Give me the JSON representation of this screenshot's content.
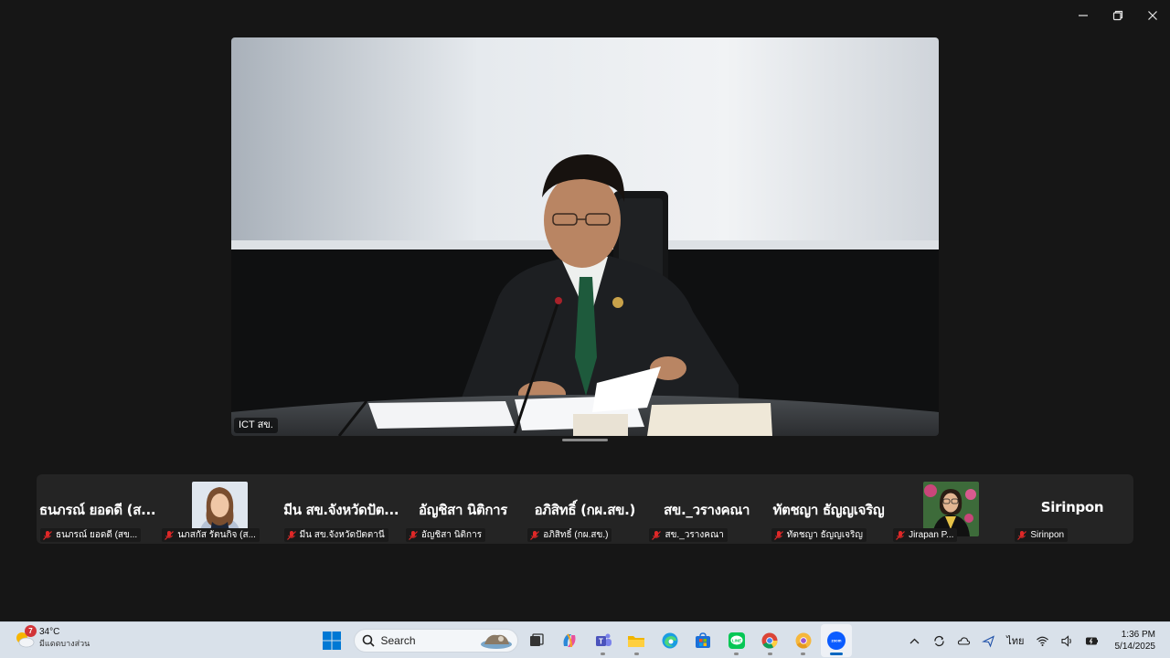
{
  "window": {
    "controls": [
      "minimize",
      "restore",
      "close"
    ]
  },
  "speaker": {
    "name": "ICT สข."
  },
  "participants": [
    {
      "display": "ธนภรณ์  ยอดดี (ส...",
      "label": "ธนภรณ์  ยอดดี (สข...",
      "muted": true,
      "video": false
    },
    {
      "display": "",
      "label": "นภสกัส รัตนกิจ (ส...",
      "muted": true,
      "video": true
    },
    {
      "display": "มีน สข.จังหวัดปัต...",
      "label": "มีน สข.จังหวัดปัตตานี",
      "muted": true,
      "video": false
    },
    {
      "display": "อัญชิสา นิติการ",
      "label": "อัญชิสา นิติการ",
      "muted": true,
      "video": false
    },
    {
      "display": "อภิสิทธิ์ (กผ.สข.)",
      "label": "อภิสิทธิ์ (กผ.สข.)",
      "muted": true,
      "video": false
    },
    {
      "display": "สข._วรางคณา",
      "label": "สข._วรางคณา",
      "muted": true,
      "video": false
    },
    {
      "display": "ทัตชญา  ธัญญเจริญ",
      "label": "ทัตชญา  ธัญญเจริญ",
      "muted": true,
      "video": false
    },
    {
      "display": "",
      "label": "Jirapan P...",
      "muted": true,
      "video": true
    },
    {
      "display": "Sirinpon",
      "label": "Sirinpon",
      "muted": true,
      "video": false
    }
  ],
  "taskbar": {
    "weather": {
      "temp": "34°C",
      "desc": "มีแดดบางส่วน",
      "badge": "7"
    },
    "search_label": "Search",
    "apps": [
      "start-icon",
      "task-view-icon",
      "copilot-icon",
      "teams-icon",
      "file-explorer-icon",
      "edge-icon",
      "microsoft-store-icon",
      "line-icon",
      "chrome-icon",
      "chrome-canary-icon",
      "zoom-icon"
    ],
    "language": "ไทย",
    "time": "1:36 PM",
    "date": "5/14/2025"
  }
}
